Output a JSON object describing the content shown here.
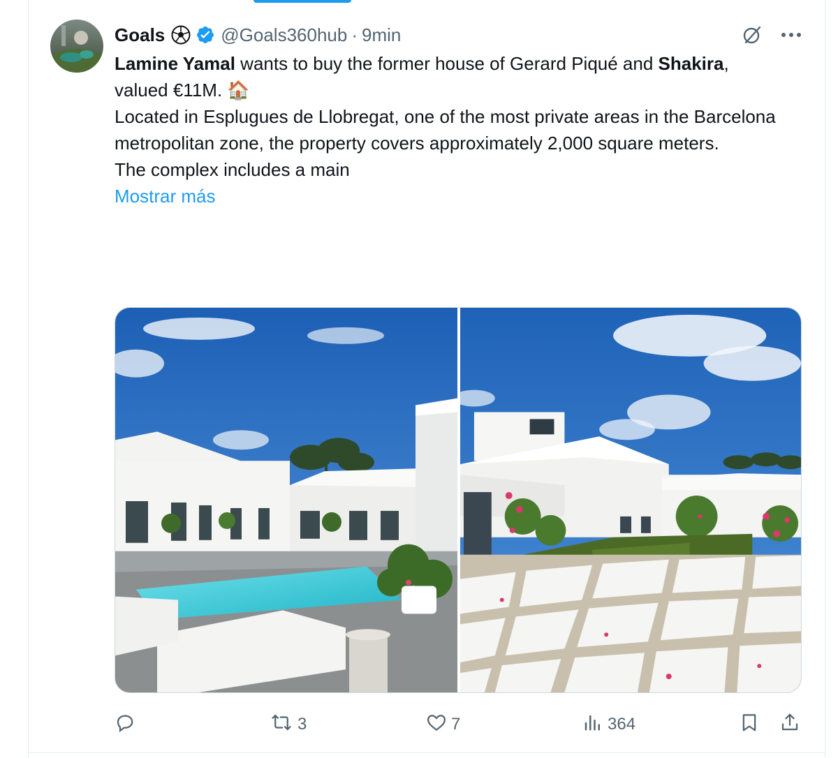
{
  "tweet": {
    "author_name": "Goals",
    "author_emoji": "⚽",
    "handle": "@Goals360hub",
    "separator": "·",
    "time": "9min",
    "text": {
      "bold_1": "Lamine Yamal",
      "part_1": " wants to buy the former house of Gerard Piqué and ",
      "bold_2": "Shakira",
      "part_2": ",",
      "line_2": "valued €11M. ",
      "house_emoji": "🏠",
      "paragraph_2": "Located in Esplugues de Llobregat, one of the most private areas in the Barcelona metropolitan zone, the property covers approximately 2,000 square meters.",
      "paragraph_3": "The complex includes a main"
    },
    "show_more": "Mostrar más"
  },
  "stats": {
    "replies": "",
    "retweets": "3",
    "likes": "7",
    "views": "364"
  },
  "icons": {
    "verified": "verified-badge-icon",
    "grok": "grok-icon",
    "more": "more-icon",
    "reply": "reply-icon",
    "retweet": "retweet-icon",
    "like": "heart-icon",
    "views": "views-icon",
    "bookmark": "bookmark-icon",
    "share": "share-icon"
  },
  "colors": {
    "accent": "#1d9bf0",
    "text": "#0f1419",
    "muted": "#536471",
    "border": "#cfd9de"
  }
}
